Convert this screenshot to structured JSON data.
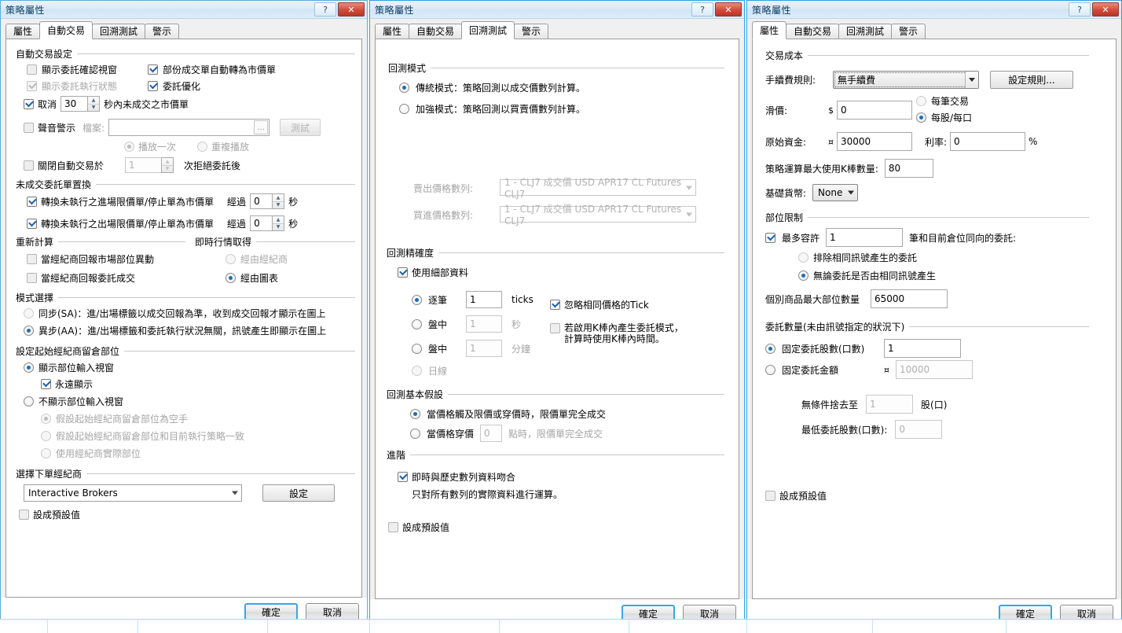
{
  "window_title": "策略屬性",
  "window_buttons": {
    "help": "?",
    "close": "✕"
  },
  "tabs": [
    "屬性",
    "自動交易",
    "回溯測試",
    "警示"
  ],
  "footer": {
    "ok": "確定",
    "cancel": "取消"
  },
  "dialog_autotrade": {
    "active_tab": "自動交易",
    "groups": {
      "auto_settings": "自動交易設定",
      "unfilled_replace": "未成交委託單置換",
      "recalc": "重新計算",
      "realtime_quote": "即時行情取得",
      "mode_select": "模式選擇",
      "initial_broker_position": "設定起始經紀商留倉部位",
      "select_broker": "選擇下單經紀商"
    },
    "show_order_confirm": {
      "label": "顯示委託確認視窗",
      "checked": false
    },
    "show_order_status": {
      "label": "顯示委託執行狀態",
      "checked": true,
      "disabled": true
    },
    "partial_fill_to_market": {
      "label": "部份成交單自動轉為市價單",
      "checked": true
    },
    "order_optimize": {
      "label": "委託優化",
      "checked": true
    },
    "cancel_unfilled": {
      "label": "取消",
      "checked": true,
      "value": "30",
      "suffix": "秒內未成交之市價單"
    },
    "sound_alert": {
      "label": "聲音警示",
      "checked": false,
      "file_label": "檔案:",
      "file_value": "",
      "browse": "...",
      "test": "測試"
    },
    "play_once": {
      "label": "播放一次",
      "selected": true
    },
    "play_repeat": {
      "label": "重複播放",
      "selected": false
    },
    "disable_auto_trade": {
      "label": "關閉自動交易於",
      "checked": false,
      "value": "1",
      "suffix": "次拒絕委託後"
    },
    "convert_entry": {
      "label": "轉換未執行之進場限價單/停止單為市價單",
      "checked": true,
      "after": "經過",
      "value": "0",
      "unit": "秒"
    },
    "convert_exit": {
      "label": "轉換未執行之出場限價單/停止單為市價單",
      "checked": true,
      "after": "經過",
      "value": "0",
      "unit": "秒"
    },
    "recalc_on_position": {
      "label": "當經紀商回報市場部位異動",
      "checked": false
    },
    "recalc_on_fill": {
      "label": "當經紀商回報委託成交",
      "checked": false
    },
    "quote_via_broker": {
      "label": "經由經紀商",
      "selected": false
    },
    "quote_via_chart": {
      "label": "經由圖表",
      "selected": true
    },
    "mode_sa": {
      "label": "同步(SA)：進/出場標籤以成交回報為準，收到成交回報才顯示在圖上",
      "selected": false
    },
    "mode_aa": {
      "label": "異步(AA)：進/出場標籤和委託執行狀況無關，訊號產生即顯示在圖上",
      "selected": true
    },
    "show_position_dialog": {
      "label": "顯示部位輸入視窗",
      "selected": true
    },
    "always_show": {
      "label": "永遠顯示",
      "checked": true
    },
    "hide_position_dialog": {
      "label": "不顯示部位輸入視窗",
      "selected": false
    },
    "assume_flat": {
      "label": "假設起始經紀商留倉部位為空手",
      "selected": true,
      "disabled": true
    },
    "assume_match_strategy": {
      "label": "假設起始經紀商留倉部位和目前執行策略一致",
      "selected": false,
      "disabled": true
    },
    "use_broker_actual": {
      "label": "使用經紀商實際部位",
      "selected": false,
      "disabled": true
    },
    "broker_combo": {
      "value": "Interactive Brokers"
    },
    "broker_settings_btn": "設定",
    "set_default": {
      "label": "設成預設值",
      "checked": false
    }
  },
  "dialog_backtest": {
    "active_tab": "回溯測試",
    "groups": {
      "backtest_mode": "回測模式",
      "precision": "回測精確度",
      "assumptions": "回測基本假設",
      "advanced": "進階"
    },
    "mode_traditional": {
      "label": "傳統模式：策略回測以成交價數列計算。",
      "selected": true
    },
    "mode_enhanced": {
      "label": "加強模式：策略回測以買賣價數列計算。",
      "selected": false
    },
    "ask_series": {
      "label": "賣出價格數列:",
      "value": "1 - CLJ7 成交價 USD APR17 CL Futures CLJ7"
    },
    "bid_series": {
      "label": "買進價格數列:",
      "value": "1 - CLJ7 成交價 USD APR17 CL Futures CLJ7"
    },
    "use_detail_data": {
      "label": "使用細部資料",
      "checked": true
    },
    "tick_option": {
      "label": "逐筆",
      "selected": true,
      "value": "1",
      "unit": "ticks"
    },
    "second_option": {
      "label": "盤中",
      "selected": false,
      "value": "1",
      "unit": "秒"
    },
    "minute_option": {
      "label": "盤中",
      "selected": false,
      "value": "1",
      "unit": "分鐘"
    },
    "daily_option": {
      "label": "日線",
      "selected": false
    },
    "ignore_same_price_tick": {
      "label": "忽略相同價格的Tick",
      "checked": true
    },
    "use_intrabar_time": {
      "label": "若啟用K棒內產生委託模式，\n計算時使用K棒內時間。",
      "checked": false
    },
    "assume_touch": {
      "label": "當價格觸及限價或穿價時，限價單完全成交",
      "selected": true
    },
    "assume_through": {
      "label": "當價格穿價",
      "selected": false,
      "value": "0",
      "suffix": "點時，限價單完全成交"
    },
    "match_realtime_history": {
      "label": "即時與歷史數列資料吻合",
      "checked": true
    },
    "match_note": "只對所有數列的實際資料進行運算。",
    "set_default": {
      "label": "設成預設值",
      "checked": false
    }
  },
  "dialog_properties": {
    "active_tab": "屬性",
    "groups": {
      "trade_cost": "交易成本",
      "position_limit": "部位限制",
      "order_qty": "委託數量(未由訊號指定的狀況下)"
    },
    "commission_rule": {
      "label": "手續費規則:",
      "value": "無手續費",
      "button": "設定規則..."
    },
    "slippage": {
      "label": "滑價:",
      "currency": "$",
      "value": "0"
    },
    "per_trade": {
      "label": "每筆交易",
      "selected": false
    },
    "per_share": {
      "label": "每股/每口",
      "selected": true
    },
    "initial_capital": {
      "label": "原始資金:",
      "currency": "¤",
      "value": "30000"
    },
    "interest_rate": {
      "label": "利率:",
      "value": "0",
      "unit": "%"
    },
    "max_bars": {
      "label": "策略運算最大使用K棒數量:",
      "value": "80"
    },
    "base_currency": {
      "label": "基礎貨幣:",
      "value": "None"
    },
    "max_allow": {
      "label": "最多容許",
      "checked": true,
      "value": "1",
      "suffix": "筆和目前倉位同向的委託:"
    },
    "exclude_same_signal": {
      "label": "排除相同訊號產生的委託",
      "selected": false,
      "disabled": true
    },
    "regardless_signal": {
      "label": "無論委託是否由相同訊號產生",
      "selected": true
    },
    "max_position_per_symbol": {
      "label": "個別商品最大部位數量",
      "value": "65000"
    },
    "fixed_shares": {
      "label": "固定委託股數(口數)",
      "selected": true,
      "value": "1"
    },
    "fixed_amount": {
      "label": "固定委託金額",
      "selected": false,
      "currency": "¤",
      "value": "10000"
    },
    "round_down": {
      "label": "無條件捨去至",
      "value": "1",
      "unit": "股(口)"
    },
    "min_shares": {
      "label": "最低委託股數(口數):",
      "value": "0"
    },
    "set_default": {
      "label": "設成預設值",
      "checked": false
    }
  }
}
